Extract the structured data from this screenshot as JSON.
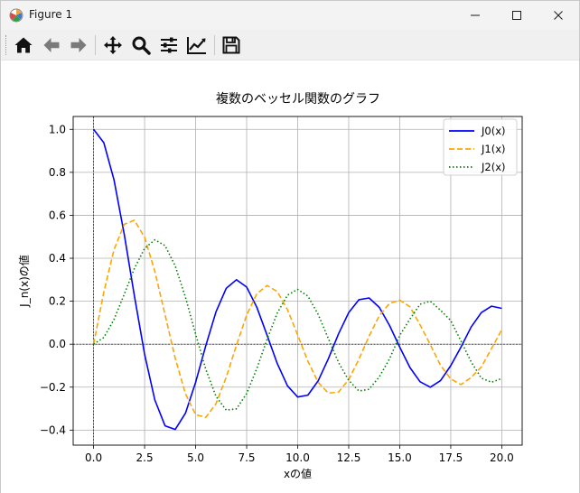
{
  "window": {
    "title": "Figure 1",
    "controls": {
      "minimize": "minimize",
      "maximize": "maximize",
      "close": "close"
    }
  },
  "toolbar": {
    "items": [
      {
        "name": "home-icon",
        "tooltip": "Home"
      },
      {
        "name": "back-arrow-icon",
        "tooltip": "Back"
      },
      {
        "name": "forward-arrow-icon",
        "tooltip": "Forward"
      },
      {
        "name": "pan-icon",
        "tooltip": "Pan"
      },
      {
        "name": "zoom-icon",
        "tooltip": "Zoom"
      },
      {
        "name": "subplots-icon",
        "tooltip": "Subplots"
      },
      {
        "name": "customize-icon",
        "tooltip": "Customize"
      },
      {
        "name": "save-icon",
        "tooltip": "Save"
      }
    ]
  },
  "colors": {
    "j0": "#0000ff",
    "j1": "#ffa500",
    "j2": "#008000",
    "grid": "#b0b0b0"
  },
  "chart_data": {
    "type": "line",
    "title": "複数のベッセル関数のグラフ",
    "xlabel": "xの値",
    "ylabel": "J_n(x)の値",
    "xlim": [
      -1.0,
      21.0
    ],
    "ylim": [
      -0.47,
      1.06
    ],
    "xticks": [
      0.0,
      2.5,
      5.0,
      7.5,
      10.0,
      12.5,
      15.0,
      17.5,
      20.0
    ],
    "xtick_labels": [
      "0.0",
      "2.5",
      "5.0",
      "7.5",
      "10.0",
      "12.5",
      "15.0",
      "17.5",
      "20.0"
    ],
    "yticks": [
      -0.4,
      -0.2,
      0.0,
      0.2,
      0.4,
      0.6,
      0.8,
      1.0
    ],
    "ytick_labels": [
      "−0.4",
      "−0.2",
      "0.0",
      "0.2",
      "0.4",
      "0.6",
      "0.8",
      "1.0"
    ],
    "grid": true,
    "legend_position": "top-right",
    "x": [
      0.0,
      0.5,
      1.0,
      1.5,
      2.0,
      2.5,
      3.0,
      3.5,
      4.0,
      4.5,
      5.0,
      5.5,
      6.0,
      6.5,
      7.0,
      7.5,
      8.0,
      8.5,
      9.0,
      9.5,
      10.0,
      10.5,
      11.0,
      11.5,
      12.0,
      12.5,
      13.0,
      13.5,
      14.0,
      14.5,
      15.0,
      15.5,
      16.0,
      16.5,
      17.0,
      17.5,
      18.0,
      18.5,
      19.0,
      19.5,
      20.0
    ],
    "series": [
      {
        "name": "J0(x)",
        "style": "solid",
        "color": "#0000ff",
        "values": [
          1.0,
          0.938,
          0.765,
          0.512,
          0.224,
          -0.048,
          -0.26,
          -0.38,
          -0.397,
          -0.321,
          -0.178,
          -0.007,
          0.151,
          0.26,
          0.3,
          0.266,
          0.172,
          0.042,
          -0.09,
          -0.194,
          -0.246,
          -0.237,
          -0.171,
          -0.068,
          0.048,
          0.147,
          0.207,
          0.215,
          0.171,
          0.087,
          -0.014,
          -0.109,
          -0.175,
          -0.2,
          -0.17,
          -0.1,
          -0.014,
          0.08,
          0.147,
          0.177,
          0.167
        ]
      },
      {
        "name": "J1(x)",
        "style": "dashed",
        "color": "#ffa500",
        "values": [
          0.0,
          0.242,
          0.44,
          0.558,
          0.577,
          0.497,
          0.339,
          0.137,
          -0.066,
          -0.231,
          -0.328,
          -0.341,
          -0.277,
          -0.154,
          -0.005,
          0.135,
          0.235,
          0.273,
          0.245,
          0.161,
          0.043,
          -0.079,
          -0.177,
          -0.228,
          -0.223,
          -0.165,
          -0.07,
          0.038,
          0.133,
          0.19,
          0.205,
          0.174,
          0.09,
          -0.002,
          -0.098,
          -0.162,
          -0.188,
          -0.155,
          -0.106,
          -0.02,
          0.067
        ]
      },
      {
        "name": "J2(x)",
        "style": "dotted",
        "color": "#008000",
        "values": [
          0.0,
          0.031,
          0.115,
          0.232,
          0.353,
          0.446,
          0.486,
          0.459,
          0.364,
          0.218,
          0.047,
          -0.117,
          -0.243,
          -0.307,
          -0.301,
          -0.23,
          -0.113,
          0.022,
          0.145,
          0.228,
          0.255,
          0.224,
          0.139,
          0.027,
          -0.085,
          -0.168,
          -0.218,
          -0.21,
          -0.152,
          -0.068,
          0.041,
          0.117,
          0.186,
          0.2,
          0.158,
          0.11,
          0.015,
          -0.082,
          -0.158,
          -0.177,
          -0.16
        ]
      }
    ]
  }
}
